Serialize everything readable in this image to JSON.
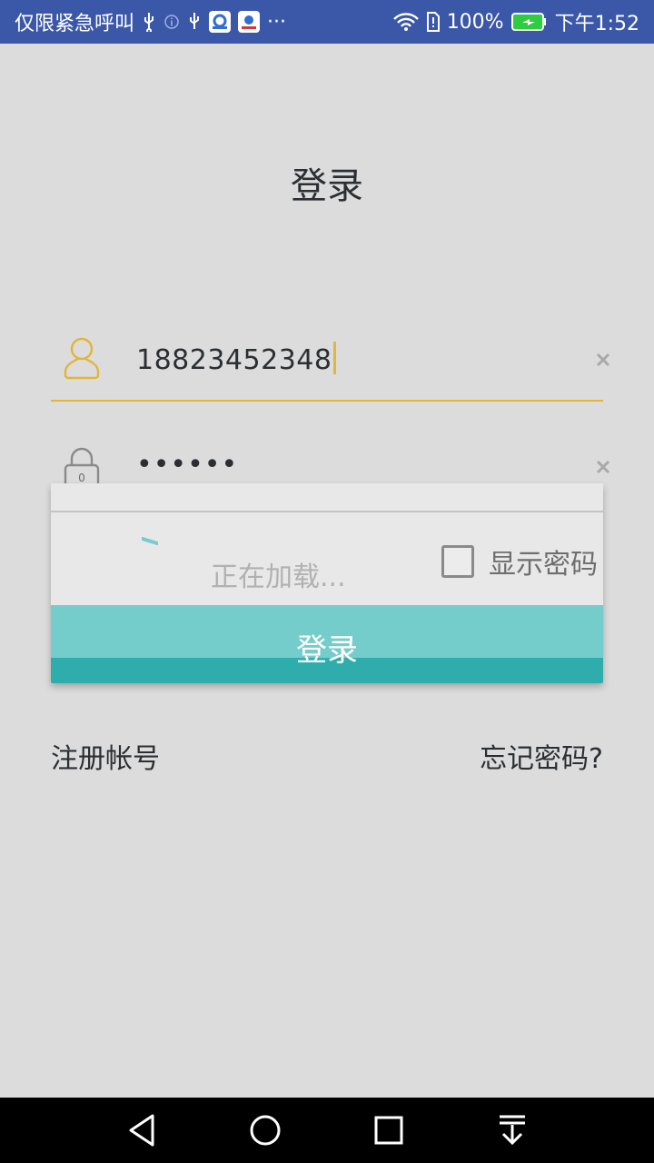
{
  "status_bar": {
    "carrier_text": "仅限紧急呼叫",
    "more": "···",
    "battery": "100%",
    "time": "下午1:52",
    "icons": [
      "usb-icon",
      "info-icon",
      "usb-icon",
      "app-notification-icon",
      "baidu-icon",
      "wifi-icon",
      "sim-icon",
      "battery-icon"
    ]
  },
  "page": {
    "title": "登录"
  },
  "username_field": {
    "value": "18823452348",
    "icon": "user-icon",
    "clear_icon": "close-icon"
  },
  "password_field": {
    "value": "••••••",
    "icon": "lock-icon",
    "lock_badge": "0",
    "clear_icon": "close-icon"
  },
  "loading_dialog": {
    "text": "正在加载..."
  },
  "show_password": {
    "label": "显示密码",
    "checked": false
  },
  "login_button": {
    "label": "登录"
  },
  "links": {
    "register": "注册帐号",
    "forgot": "忘记密码?"
  },
  "colors": {
    "status_bar": "#3a57a8",
    "accent": "#e2b53b",
    "button": "#2fadac",
    "button_light": "#74cccb",
    "background": "#dcdcdc"
  },
  "nav_bar": {
    "icons": [
      "back-icon",
      "home-icon",
      "recents-icon",
      "notification-pulldown-icon"
    ]
  }
}
